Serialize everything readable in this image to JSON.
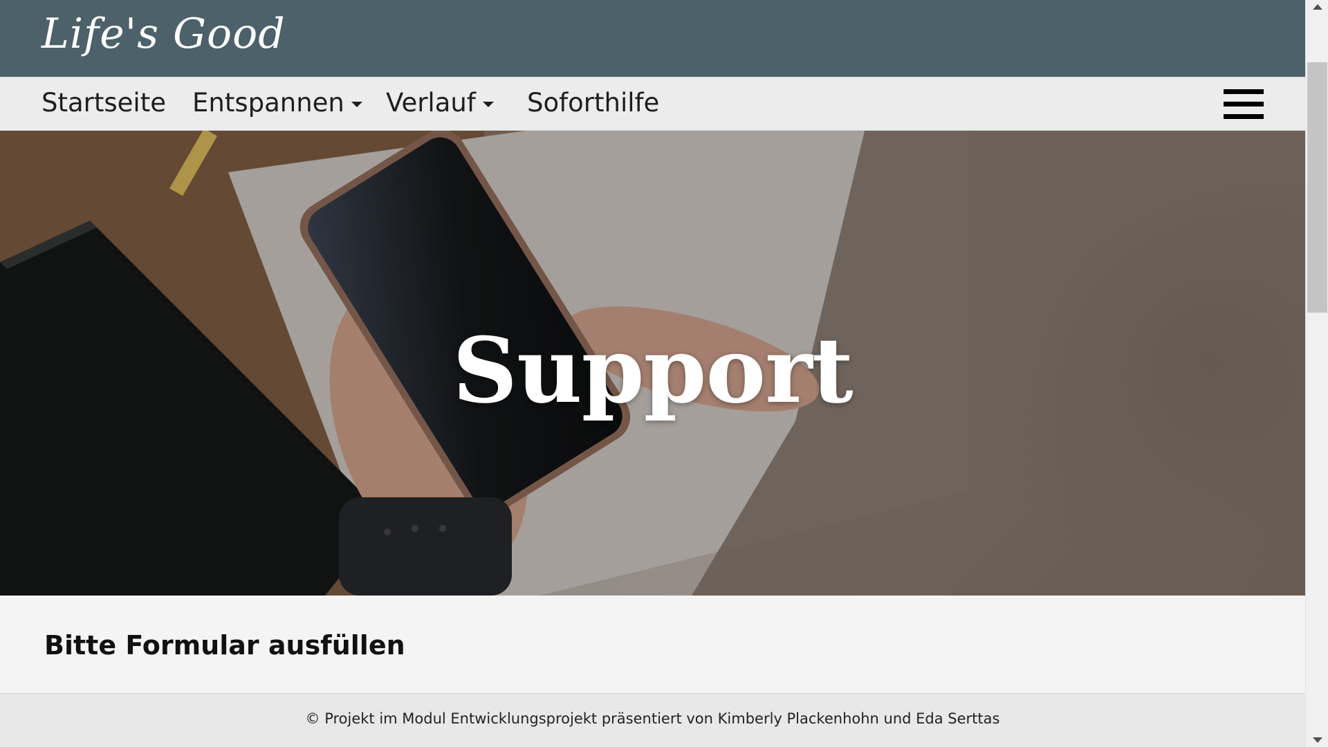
{
  "header": {
    "logo_text": "Life's Good"
  },
  "nav": {
    "items": [
      {
        "label": "Startseite",
        "has_dropdown": false
      },
      {
        "label": "Entspannen",
        "has_dropdown": true
      },
      {
        "label": "Verlauf",
        "has_dropdown": true
      },
      {
        "label": "Soforthilfe",
        "has_dropdown": false
      }
    ],
    "menu_icon": "hamburger-menu-icon"
  },
  "hero": {
    "title": "Support"
  },
  "content": {
    "heading": "Bitte Formular ausfüllen"
  },
  "footer": {
    "text": "© Projekt im Modul Entwicklungsprojekt präsentiert von Kimberly Plackenhohn und Eda Serttas"
  },
  "colors": {
    "header_bg": "#4c6169",
    "nav_bg": "#ececec",
    "page_bg": "#f4f4f4",
    "footer_bg": "#e8e8e8"
  }
}
